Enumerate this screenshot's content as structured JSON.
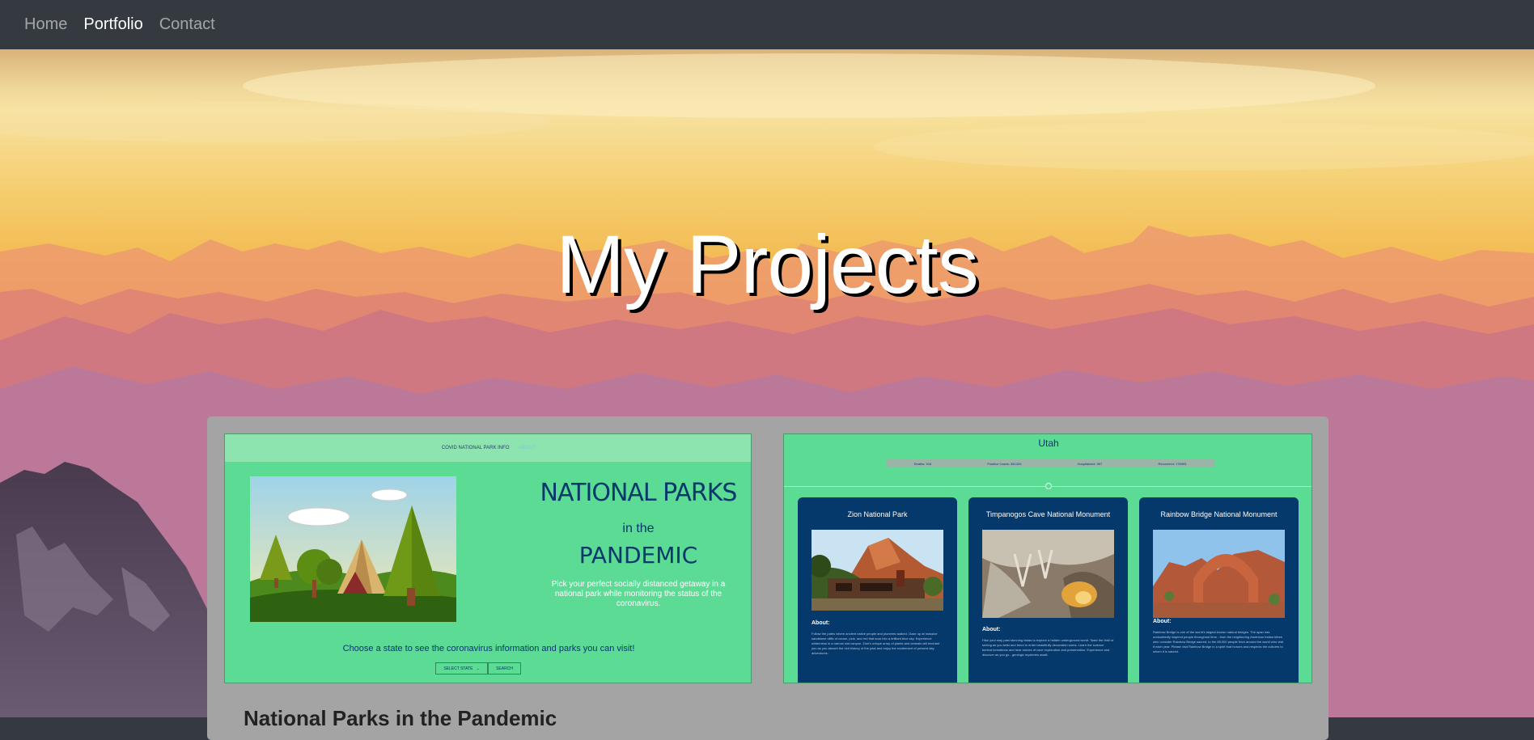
{
  "nav": {
    "links": [
      "Home",
      "Portfolio",
      "Contact"
    ],
    "active": "Portfolio"
  },
  "hero": {
    "title": "My Projects"
  },
  "colors": {
    "navbar": "#343a40",
    "panel": "#a4a4a4",
    "mint": "#5cdb95",
    "navy": "#05386b"
  },
  "projects": {
    "heading": "National Parks in the Pandemic",
    "card1": {
      "nav_left": "COVID NATIONAL PARK INFO",
      "nav_right": "ABOUT",
      "title_line1": "NATIONAL PARKS",
      "title_line2": "in the",
      "title_line3": "PANDEMIC",
      "subtitle": "Pick your perfect socially distanced getaway in a national park while monitoring the status of the coronavirus.",
      "choose": "Choose a state to see the coronavirus information and parks you can visit!",
      "select_label": "SELECT STATE",
      "search_label": "SEARCH"
    },
    "card2": {
      "state": "Utah",
      "stats": [
        "Deaths: 916",
        "Positive Cases: 361320",
        "Hospitalized: 567",
        "Recovered: 176993"
      ],
      "about_label": "About:",
      "parks": [
        {
          "name": "Zion National Park",
          "text": "Follow the paths where ancient native people and pioneers walked. Gaze up at massive sandstone cliffs of cream, pink, and red that soar into a brilliant blue sky. Experience wilderness in a narrow slot canyon. Zion's unique array of plants and animals will enchant you as you absorb the rich history of the past and enjoy the excitement of present day adventures."
        },
        {
          "name": "Timpanogos Cave National Monument",
          "text": "Hike your way past stunning vistas to explore a hidden underground world. Taste the thrill of seeing as you twist and bend to enter beautifully decorated rooms. Learn the science behind formations and hear stories of cave exploration and preservation. Experience and discover as you go - geologic mysteries await."
        },
        {
          "name": "Rainbow Bridge National Monument",
          "text": "Rainbow Bridge is one of the world's largest known natural bridges. The span has undoubtedly inspired people throughout time - from the neighboring American Indian tribes who consider Rainbow Bridge sacred, to the 85,000 people from around the world who visit it each year. Please visit Rainbow Bridge in a spirit that honors and respects the cultures to whom it is sacred."
        }
      ]
    }
  }
}
